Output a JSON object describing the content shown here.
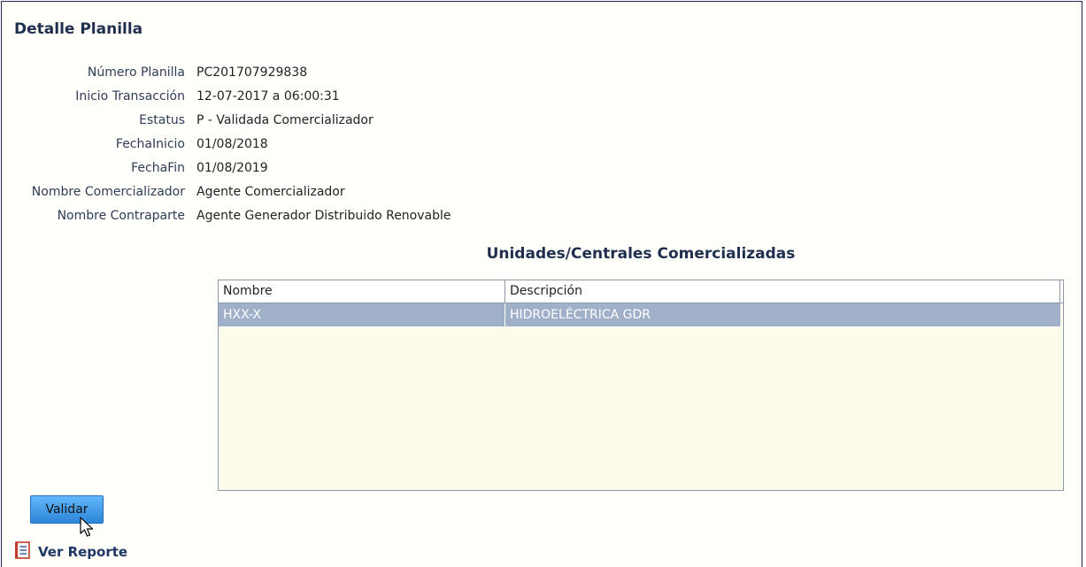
{
  "page": {
    "title": "Detalle Planilla"
  },
  "details": [
    {
      "label": "Número Planilla",
      "value": "PC201707929838"
    },
    {
      "label": "Inicio Transacción",
      "value": "12-07-2017 a 06:00:31"
    },
    {
      "label": "Estatus",
      "value": "P - Validada Comercializador"
    },
    {
      "label": "FechaInicio",
      "value": "01/08/2018"
    },
    {
      "label": "FechaFin",
      "value": "01/08/2019"
    },
    {
      "label": "Nombre Comercializador",
      "value": "Agente Comercializador"
    },
    {
      "label": "Nombre Contraparte",
      "value": "Agente Generador Distribuido Renovable"
    }
  ],
  "units": {
    "title": "Unidades/Centrales Comercializadas",
    "columns": [
      "Nombre",
      "Descripción"
    ],
    "rows": [
      [
        "HXX-X",
        "HIDROELÉCTRICA GDR"
      ]
    ],
    "selected_row_color": "#a1b0c9"
  },
  "actions": {
    "validate_label": "Validar",
    "report_label": "Ver Reporte"
  },
  "colors": {
    "border": "#1d2b55",
    "title_text": "#1f2f4d",
    "button_top": "#62b8fa",
    "button_bottom": "#2c86d8"
  },
  "icons": {
    "report": "report-document-icon",
    "cursor": "mouse-pointer-icon"
  }
}
